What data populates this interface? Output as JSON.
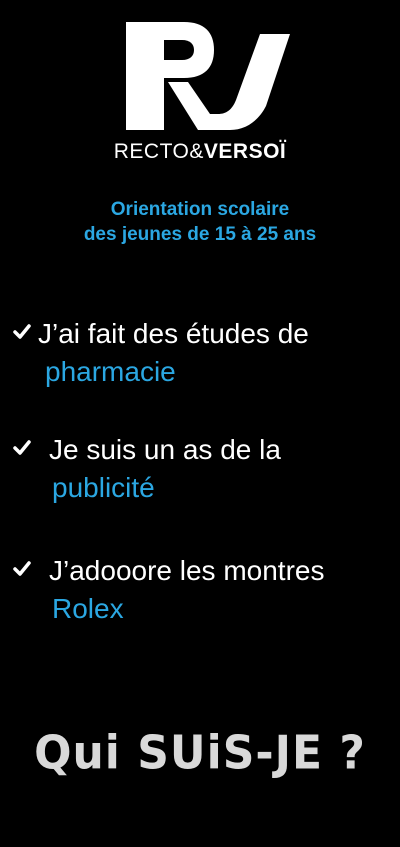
{
  "brand": {
    "logo_icon": "rv-logo-icon",
    "name_light": "RECTO&",
    "name_bold": "VERSOÏ",
    "color_logo": "#ffffff"
  },
  "subtitle": {
    "line1": "Orientation scolaire",
    "line2": "des jeunes de 15 à 25 ans",
    "color": "#2ba7e2"
  },
  "clues": [
    {
      "icon": "check-icon",
      "text": "J’ai fait des études de",
      "highlight": "pharmacie"
    },
    {
      "icon": "check-icon",
      "text": "Je suis un as de la",
      "highlight": "publicité"
    },
    {
      "icon": "check-icon",
      "text": "J’adooore les montres",
      "highlight": "Rolex"
    }
  ],
  "question": "Qui SUiS-JE ?",
  "colors": {
    "background": "#000000",
    "accent": "#2ba7e2",
    "text": "#ffffff",
    "question": "#d9d9d9"
  }
}
